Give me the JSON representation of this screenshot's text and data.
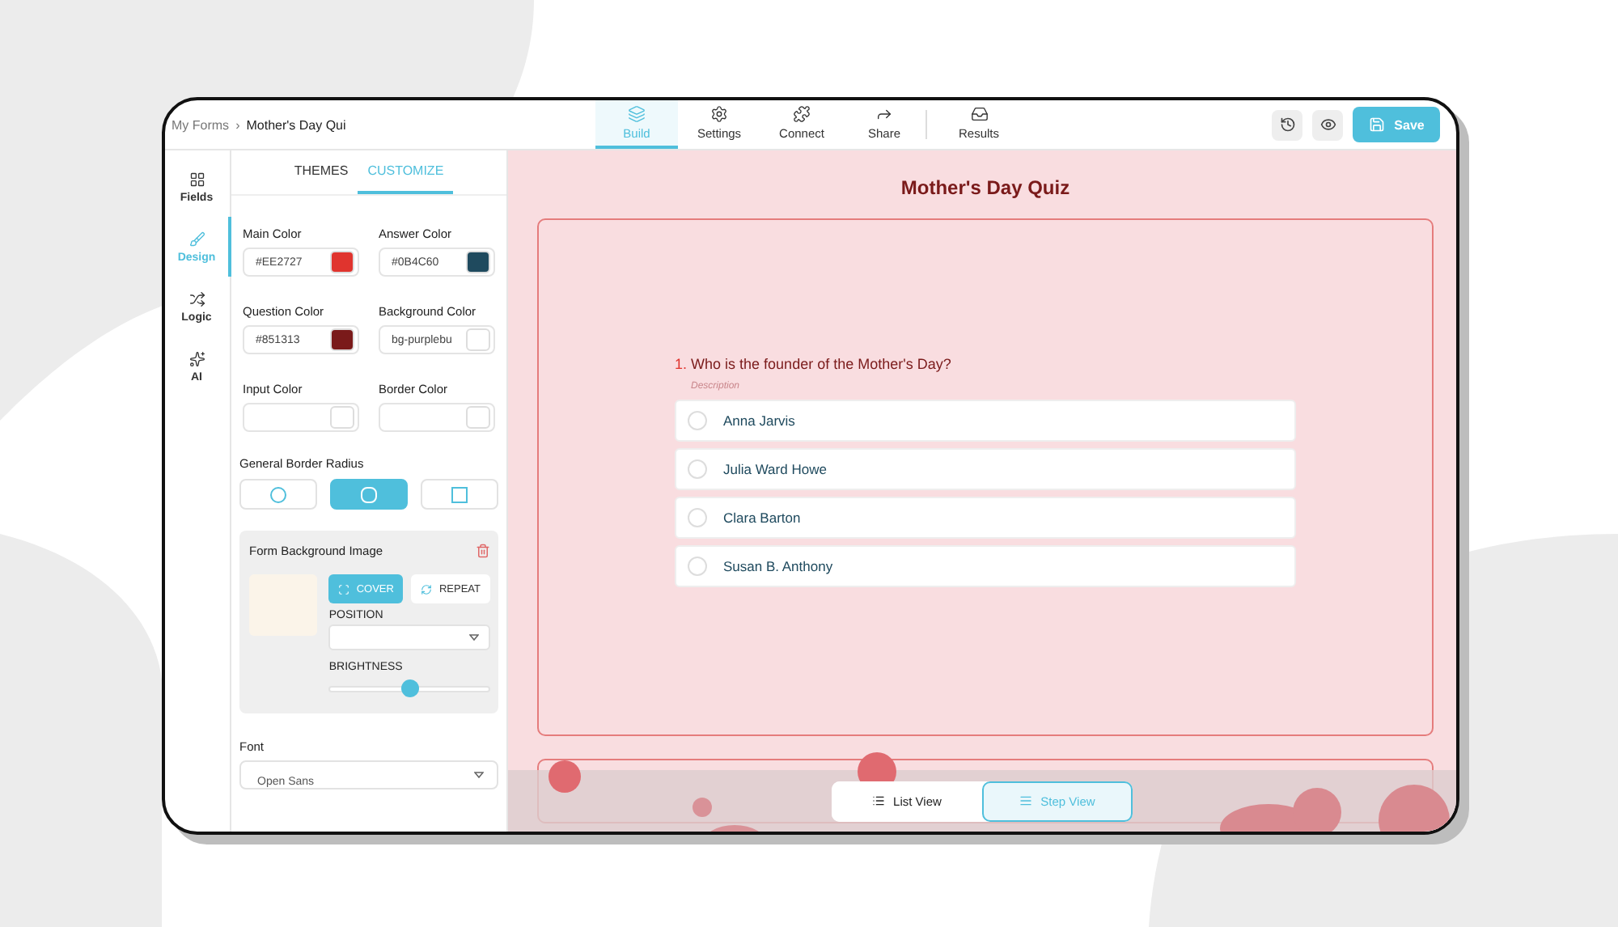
{
  "breadcrumb": {
    "parent": "My Forms",
    "separator": "›",
    "current": "Mother's Day Qui"
  },
  "nav_tabs": [
    {
      "label": "Build",
      "kind": "layers",
      "selected": true
    },
    {
      "label": "Settings",
      "kind": "gear",
      "selected": false
    },
    {
      "label": "Connect",
      "kind": "puzzle",
      "selected": false
    },
    {
      "label": "Share",
      "kind": "share",
      "selected": false
    },
    {
      "label": "Results",
      "kind": "inbox",
      "selected": false
    }
  ],
  "save_button": "Save",
  "rail": [
    {
      "label": "Fields",
      "kind": "grid",
      "selected": false
    },
    {
      "label": "Design",
      "kind": "brush",
      "selected": true
    },
    {
      "label": "Logic",
      "kind": "shuffle",
      "selected": false
    },
    {
      "label": "AI",
      "kind": "sparkle",
      "selected": false
    }
  ],
  "panel_tabs": [
    {
      "label": "THEMES",
      "selected": false
    },
    {
      "label": "CUSTOMIZE",
      "selected": true
    }
  ],
  "colors": [
    {
      "label": "Main Color",
      "value": "#EE2727",
      "color": "#e0342e"
    },
    {
      "label": "Answer Color",
      "value": "#0B4C60",
      "color": "#1f4a5e"
    },
    {
      "label": "Question Color",
      "value": "#851313",
      "color": "#7a1a1a"
    },
    {
      "label": "Background Color",
      "value": "bg-purplebu",
      "color": "#ffffff"
    },
    {
      "label": "Input Color",
      "color": "#ffffff"
    },
    {
      "label": "Border Color",
      "color": "#ffffff"
    }
  ],
  "border_radius": {
    "label": "General Border Radius",
    "options": [
      {
        "kind": "circle",
        "selected": false
      },
      {
        "kind": "rounded",
        "selected": true
      },
      {
        "kind": "square",
        "selected": false
      }
    ]
  },
  "background_image": {
    "title": "Form Background Image",
    "modes": [
      {
        "label": "COVER",
        "kind": "cover",
        "selected": true
      },
      {
        "label": "REPEAT",
        "kind": "repeat",
        "selected": false
      }
    ],
    "position_label": "POSITION",
    "brightness_label": "BRIGHTNESS",
    "brightness": {
      "level": 0.5
    }
  },
  "font": {
    "label": "Font",
    "value": "Open Sans"
  },
  "form": {
    "title": "Mother's Day Quiz",
    "question": {
      "number": "1.",
      "text": "Who is the founder of the Mother's Day?",
      "description": "Description",
      "options": [
        {
          "label": "Anna Jarvis",
          "selected": false
        },
        {
          "label": "Julia Ward Howe",
          "selected": false
        },
        {
          "label": "Clara Barton",
          "selected": false
        },
        {
          "label": "Susan B. Anthony",
          "selected": false
        }
      ]
    }
  },
  "view_toggle": [
    {
      "label": "List View",
      "kind": "list",
      "selected": false
    },
    {
      "label": "Step View",
      "kind": "step",
      "selected": true
    }
  ]
}
